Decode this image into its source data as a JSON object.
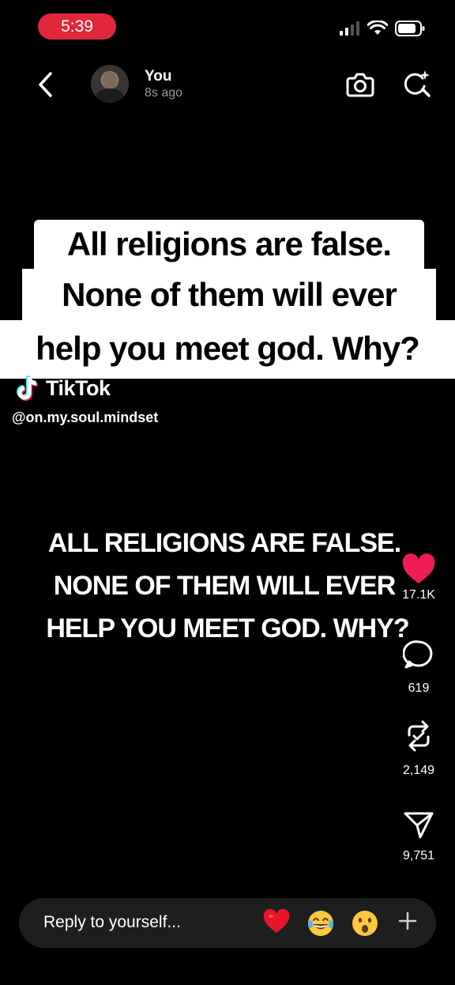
{
  "status_bar": {
    "time": "5:39"
  },
  "header": {
    "name": "You",
    "time_ago": "8s ago"
  },
  "caption": {
    "lines": [
      "All religions are false.",
      "None of them will ever",
      "help you meet god. Why?"
    ],
    "brand": "TikTok",
    "handle": "@on.my.soul.mindset"
  },
  "video_text": {
    "lines": [
      "ALL RELIGIONS ARE FALSE.",
      "NONE OF THEM WILL EVER",
      "HELP YOU MEET GOD. WHY?"
    ]
  },
  "actions": {
    "likes": "17.1K",
    "comments": "619",
    "reposts": "2,149",
    "shares": "9,751"
  },
  "reply": {
    "placeholder": "Reply to yourself..."
  },
  "colors": {
    "accent": "#e0283a",
    "like": "#ee1d52",
    "background": "#000000"
  },
  "icons": [
    "back-icon",
    "camera-icon",
    "sparkle-search-icon",
    "heart-icon",
    "comment-icon",
    "repost-icon",
    "share-icon",
    "plus-icon"
  ]
}
